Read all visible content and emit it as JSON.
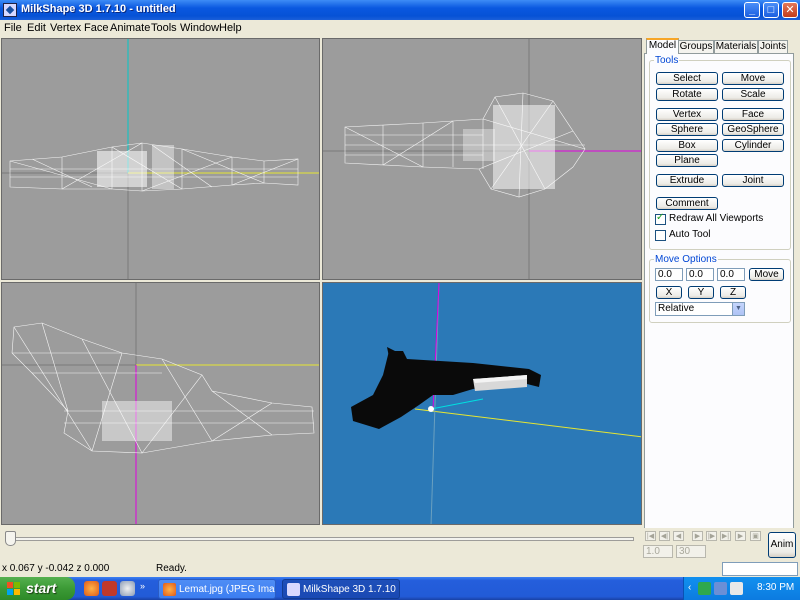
{
  "window": {
    "title": "MilkShape 3D 1.7.10 - untitled",
    "controls": {
      "minimize": "_",
      "maximize": "□",
      "close": "✕"
    }
  },
  "menu": [
    "File",
    "Edit",
    "Vertex",
    "Face",
    "Animate",
    "Tools",
    "Window",
    "Help"
  ],
  "panel": {
    "tabs": [
      "Model",
      "Groups",
      "Materials",
      "Joints"
    ],
    "active_tab": "Model",
    "tools_label": "Tools",
    "tool_buttons": [
      "Select",
      "Move",
      "Rotate",
      "Scale",
      "Vertex",
      "Face",
      "Sphere",
      "GeoSphere",
      "Box",
      "Cylinder",
      "Plane",
      "Extrude",
      "Joint",
      "Comment"
    ],
    "redraw_all_viewports": {
      "label": "Redraw All Viewports",
      "checked": true
    },
    "auto_tool": {
      "label": "Auto Tool",
      "checked": false
    },
    "move_options_label": "Move Options",
    "move_x": "0.0",
    "move_y": "0.0",
    "move_z": "0.0",
    "move_button": "Move",
    "axis_buttons": [
      "X",
      "Y",
      "Z"
    ],
    "mode_select": "Relative"
  },
  "timeline": {
    "frame_start": "1.0",
    "frame_end": "30",
    "anim_button": "Anim",
    "nav_icons": [
      "first-frame-icon",
      "prev-key-icon",
      "prev-frame-icon",
      "next-frame-icon",
      "next-key-icon",
      "last-frame-icon",
      "play-icon"
    ]
  },
  "status": {
    "coords": "x 0.067 y -0.042 z 0.000",
    "message": "Ready."
  },
  "taskbar": {
    "start_label": "start",
    "tasks": [
      {
        "label": "Lemat.jpg (JPEG Ima...",
        "active": false
      },
      {
        "label": "MilkShape 3D 1.7.10 ...",
        "active": true
      }
    ],
    "clock": "8:30 PM"
  },
  "colors": {
    "viewport_grey": "#9c9c9c",
    "viewport_3d": "#2b79b7",
    "axis_cyan": "#00c8c8",
    "axis_yellow": "#e6e632",
    "axis_magenta": "#e000e0",
    "wire": "#ffffff"
  }
}
